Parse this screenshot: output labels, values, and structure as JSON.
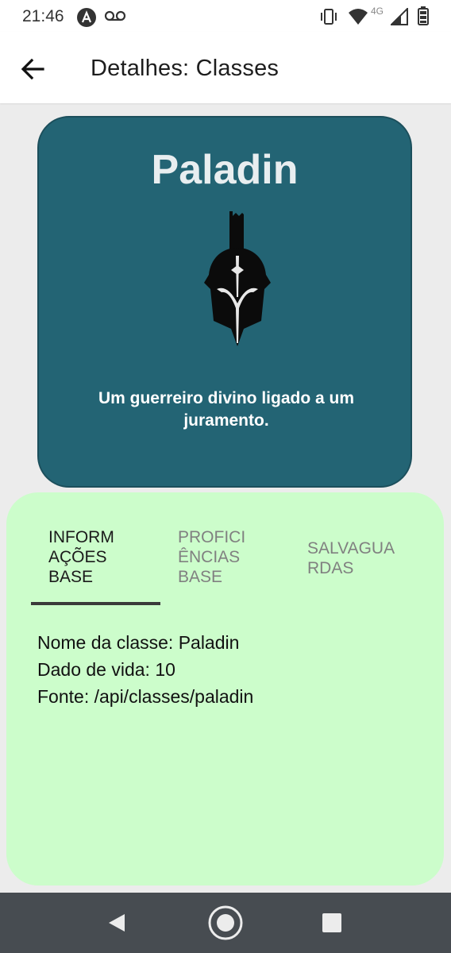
{
  "status_bar": {
    "time": "21:46",
    "network": "4G",
    "icons": [
      "app-icon",
      "voicemail-icon",
      "vibrate-icon",
      "wifi-icon",
      "signal-icon",
      "battery-icon"
    ]
  },
  "app_bar": {
    "title": "Detalhes: Classes",
    "back_icon": "arrow-left-icon"
  },
  "class_card": {
    "name": "Paladin",
    "description": "Um guerreiro divino ligado a um juramento.",
    "emblem_icon": "helmet-icon",
    "background_color": "#236474"
  },
  "tabs": [
    {
      "label": "INFORMAÇÕES BASE",
      "active": true
    },
    {
      "label": "PROFICIÊNCIAS BASE",
      "active": false
    },
    {
      "label": "SALVAGUARDAS",
      "active": false
    }
  ],
  "info": {
    "lines": [
      "Nome da classe: Paladin",
      "Dado de vida: 10",
      "Fonte: /api/classes/paladin"
    ]
  },
  "nav_bar": {
    "icons": [
      "back-triangle-icon",
      "home-circle-icon",
      "recents-square-icon"
    ]
  },
  "colors": {
    "panel_background": "#ccfdcb",
    "nav_background": "#474c51"
  }
}
